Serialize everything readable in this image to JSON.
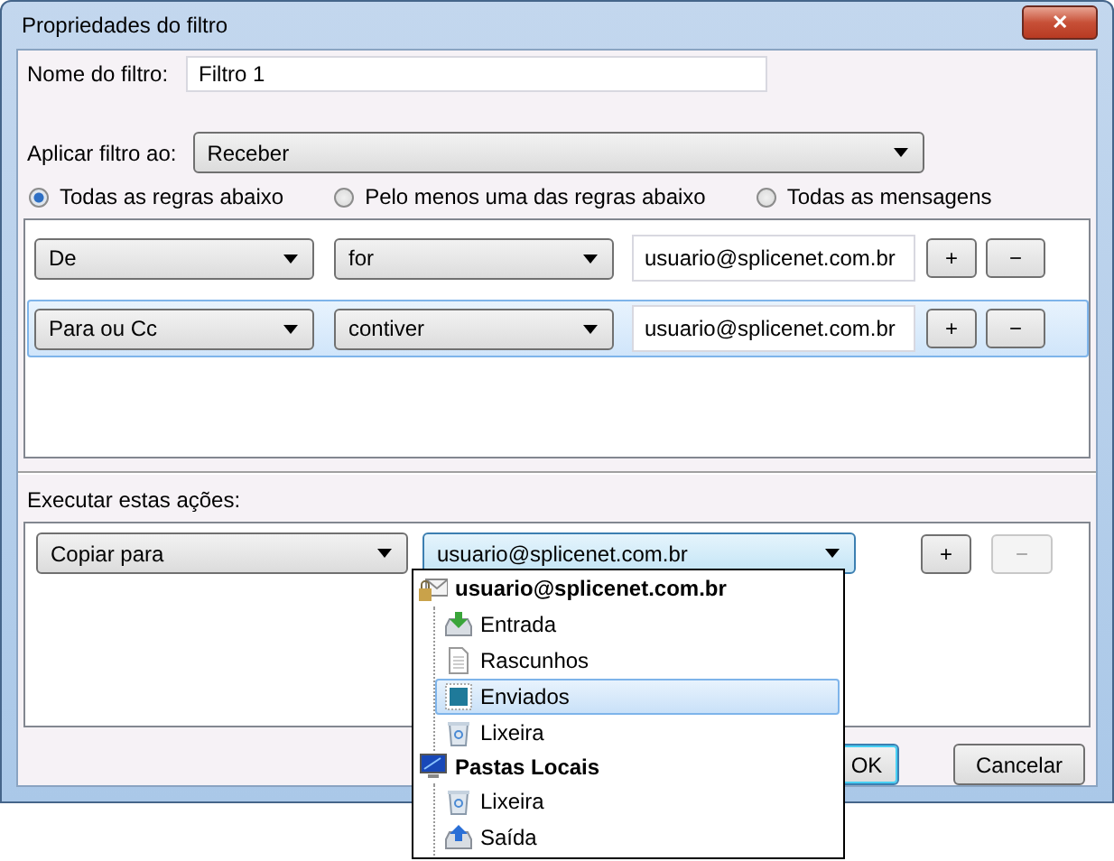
{
  "window": {
    "title": "Propriedades do filtro",
    "close": "✕"
  },
  "filter_name": {
    "label": "Nome do filtro:",
    "value": "Filtro 1"
  },
  "apply_to": {
    "label": "Aplicar filtro ao:",
    "value": "Receber"
  },
  "match": [
    {
      "label": "Todas as regras abaixo",
      "selected": true
    },
    {
      "label": "Pelo menos uma das regras abaixo",
      "selected": false
    },
    {
      "label": "Todas as mensagens",
      "selected": false
    }
  ],
  "rules": [
    {
      "field": "De",
      "operator": "for",
      "value": "usuario@splicenet.com.br",
      "add": "+",
      "remove": "−",
      "selected": false
    },
    {
      "field": "Para ou Cc",
      "operator": "contiver",
      "value": "usuario@splicenet.com.br",
      "add": "+",
      "remove": "−",
      "selected": true
    }
  ],
  "actions_label": "Executar estas ações:",
  "actions": [
    {
      "action": "Copiar para",
      "target": "usuario@splicenet.com.br",
      "add": "+",
      "remove": "−",
      "remove_disabled": true
    }
  ],
  "folder_menu": {
    "items": [
      {
        "label": "usuario@splicenet.com.br",
        "kind": "account",
        "selected": false,
        "children": [
          {
            "label": "Entrada",
            "kind": "inbox",
            "selected": false
          },
          {
            "label": "Rascunhos",
            "kind": "drafts",
            "selected": false
          },
          {
            "label": "Enviados",
            "kind": "sent",
            "selected": true
          },
          {
            "label": "Lixeira",
            "kind": "trash",
            "selected": false
          }
        ]
      },
      {
        "label": "Pastas Locais",
        "kind": "local",
        "selected": false,
        "children": [
          {
            "label": "Lixeira",
            "kind": "trash",
            "selected": false
          },
          {
            "label": "Saída",
            "kind": "outbox",
            "selected": false
          }
        ]
      }
    ]
  },
  "buttons": [
    {
      "label": "OK",
      "default": true
    },
    {
      "label": "Cancelar",
      "default": false
    }
  ]
}
